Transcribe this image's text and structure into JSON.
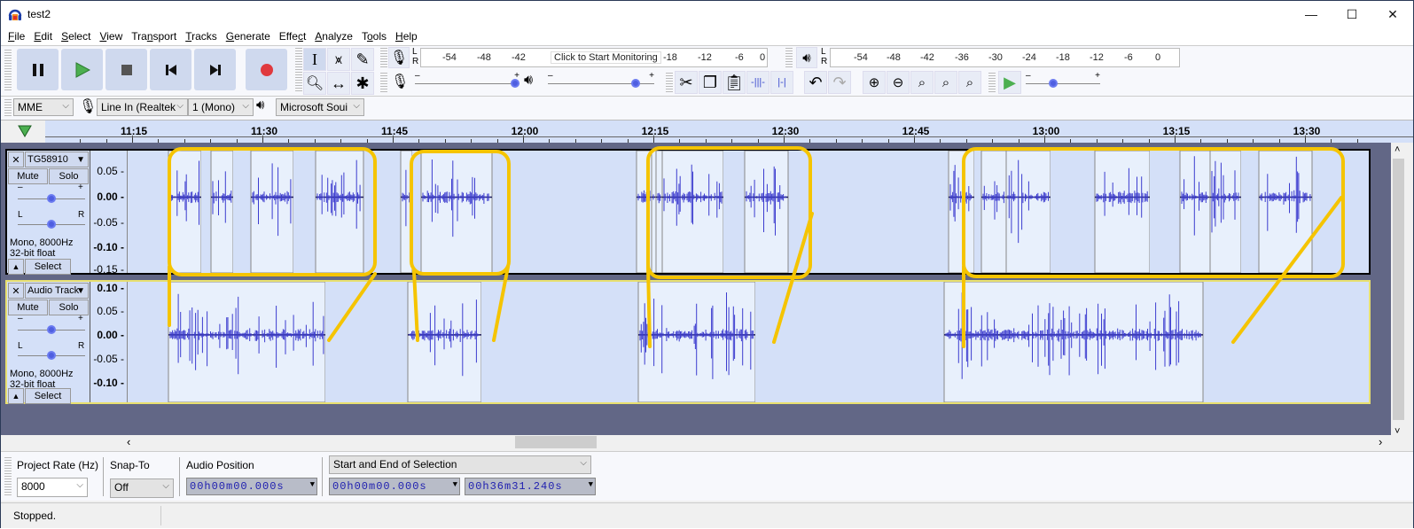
{
  "window": {
    "title": "test2",
    "controls": {
      "minimize": "—",
      "maximize": "☐",
      "close": "✕"
    }
  },
  "menu": [
    {
      "label": "File",
      "u": "F",
      "rest": "ile"
    },
    {
      "label": "Edit",
      "u": "E",
      "rest": "dit"
    },
    {
      "label": "Select",
      "u": "S",
      "rest": "elect"
    },
    {
      "label": "View",
      "u": "V",
      "rest": "iew"
    },
    {
      "label": "Transport",
      "pre": "Tra",
      "u": "n",
      "rest": "sport"
    },
    {
      "label": "Tracks",
      "u": "T",
      "rest": "racks"
    },
    {
      "label": "Generate",
      "u": "G",
      "rest": "enerate"
    },
    {
      "label": "Effect",
      "pre": "Effe",
      "u": "c",
      "rest": "t"
    },
    {
      "label": "Analyze",
      "u": "A",
      "rest": "nalyze"
    },
    {
      "label": "Tools",
      "pre": "T",
      "u": "o",
      "rest": "ols"
    },
    {
      "label": "Help",
      "u": "H",
      "rest": "elp"
    }
  ],
  "transport": {
    "buttons": [
      "pause",
      "play",
      "stop",
      "skip-to-start",
      "skip-to-end",
      "record"
    ],
    "colors": {
      "play": "#4caf50",
      "record": "#e0393e",
      "button_bg": "#cfd9ee"
    }
  },
  "tools": {
    "row1": [
      "selection-tool",
      "envelope-tool",
      "draw-tool"
    ],
    "row2": [
      "zoom-tool",
      "time-shift-tool",
      "multi-tool"
    ]
  },
  "recording_meter": {
    "channels": [
      "L",
      "R"
    ],
    "ticks": [
      "-54",
      "-48",
      "-42",
      "-18",
      "-12",
      "-6",
      "0"
    ],
    "prompt": "Click to Start Monitoring"
  },
  "playback_meter": {
    "channels": [
      "L",
      "R"
    ],
    "ticks": [
      "-54",
      "-48",
      "-42",
      "-36",
      "-30",
      "-24",
      "-18",
      "-12",
      "-6",
      "0"
    ]
  },
  "mixer": {
    "recording_volume": 1.0,
    "playback_volume": 0.85,
    "minus": "–",
    "plus": "+"
  },
  "edit_toolbar": [
    "cut",
    "copy",
    "paste",
    "trim-audio",
    "silence-audio",
    "undo",
    "redo",
    "zoom-in",
    "zoom-out",
    "fit-selection",
    "fit-project",
    "zoom-toggle"
  ],
  "play_at_speed": {
    "speed": 0.35,
    "minus": "–",
    "plus": "+"
  },
  "device": {
    "host": "MME",
    "recording_device": "Line In (Realtek",
    "channels": "1 (Mono)",
    "playback_device": "Microsoft Soui"
  },
  "timeline": {
    "labels": [
      "11:15",
      "11:30",
      "11:45",
      "12:00",
      "12:15",
      "12:30",
      "12:45",
      "13:00",
      "13:15",
      "13:30"
    ]
  },
  "tracks": [
    {
      "name": "TG58910",
      "mute": "Mute",
      "solo": "Solo",
      "gain": 0.5,
      "pan": 0.5,
      "gain_minus": "–",
      "gain_plus": "+",
      "pan_left": "L",
      "pan_right": "R",
      "format_line1": "Mono, 8000Hz",
      "format_line2": "32-bit float",
      "select": "Select",
      "scale": [
        "0.05",
        "0.00",
        "-0.05",
        "-0.10",
        "-0.15"
      ]
    },
    {
      "name": "Audio Track",
      "mute": "Mute",
      "solo": "Solo",
      "gain": 0.5,
      "pan": 0.5,
      "gain_minus": "–",
      "gain_plus": "+",
      "pan_left": "L",
      "pan_right": "R",
      "format_line1": "Mono, 8000Hz",
      "format_line2": "32-bit float",
      "select": "Select",
      "scale": [
        "0.10",
        "0.05",
        "0.00",
        "-0.05",
        "-0.10"
      ]
    }
  ],
  "annotation_color": "#f5c400",
  "waveform_color": "#3c3ccf",
  "selection_toolbar": {
    "project_rate_label": "Project Rate (Hz)",
    "project_rate": "8000",
    "snap_to_label": "Snap-To",
    "snap_to": "Off",
    "audio_position_label": "Audio Position",
    "audio_position": "00h00m00.000s",
    "selection_mode": "Start and End of Selection",
    "selection_start": "00h00m00.000s",
    "selection_end": "00h36m31.240s"
  },
  "status": {
    "text": "Stopped."
  },
  "scroll": {
    "left": "‹",
    "right": "›",
    "up": "˄",
    "down": "˅"
  }
}
